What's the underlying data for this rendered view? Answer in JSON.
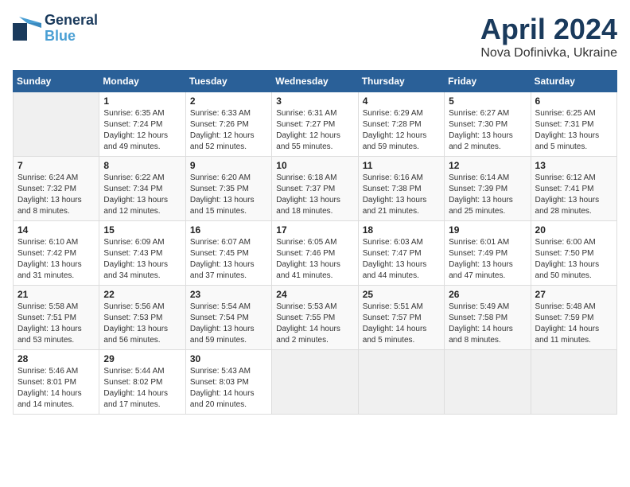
{
  "header": {
    "logo_line1": "General",
    "logo_line2": "Blue",
    "month": "April 2024",
    "location": "Nova Dofinivka, Ukraine"
  },
  "weekdays": [
    "Sunday",
    "Monday",
    "Tuesday",
    "Wednesday",
    "Thursday",
    "Friday",
    "Saturday"
  ],
  "weeks": [
    [
      {
        "day": "",
        "empty": true
      },
      {
        "day": "1",
        "sunrise": "6:35 AM",
        "sunset": "7:24 PM",
        "daylight": "12 hours and 49 minutes."
      },
      {
        "day": "2",
        "sunrise": "6:33 AM",
        "sunset": "7:26 PM",
        "daylight": "12 hours and 52 minutes."
      },
      {
        "day": "3",
        "sunrise": "6:31 AM",
        "sunset": "7:27 PM",
        "daylight": "12 hours and 55 minutes."
      },
      {
        "day": "4",
        "sunrise": "6:29 AM",
        "sunset": "7:28 PM",
        "daylight": "12 hours and 59 minutes."
      },
      {
        "day": "5",
        "sunrise": "6:27 AM",
        "sunset": "7:30 PM",
        "daylight": "13 hours and 2 minutes."
      },
      {
        "day": "6",
        "sunrise": "6:25 AM",
        "sunset": "7:31 PM",
        "daylight": "13 hours and 5 minutes."
      }
    ],
    [
      {
        "day": "7",
        "sunrise": "6:24 AM",
        "sunset": "7:32 PM",
        "daylight": "13 hours and 8 minutes."
      },
      {
        "day": "8",
        "sunrise": "6:22 AM",
        "sunset": "7:34 PM",
        "daylight": "13 hours and 12 minutes."
      },
      {
        "day": "9",
        "sunrise": "6:20 AM",
        "sunset": "7:35 PM",
        "daylight": "13 hours and 15 minutes."
      },
      {
        "day": "10",
        "sunrise": "6:18 AM",
        "sunset": "7:37 PM",
        "daylight": "13 hours and 18 minutes."
      },
      {
        "day": "11",
        "sunrise": "6:16 AM",
        "sunset": "7:38 PM",
        "daylight": "13 hours and 21 minutes."
      },
      {
        "day": "12",
        "sunrise": "6:14 AM",
        "sunset": "7:39 PM",
        "daylight": "13 hours and 25 minutes."
      },
      {
        "day": "13",
        "sunrise": "6:12 AM",
        "sunset": "7:41 PM",
        "daylight": "13 hours and 28 minutes."
      }
    ],
    [
      {
        "day": "14",
        "sunrise": "6:10 AM",
        "sunset": "7:42 PM",
        "daylight": "13 hours and 31 minutes."
      },
      {
        "day": "15",
        "sunrise": "6:09 AM",
        "sunset": "7:43 PM",
        "daylight": "13 hours and 34 minutes."
      },
      {
        "day": "16",
        "sunrise": "6:07 AM",
        "sunset": "7:45 PM",
        "daylight": "13 hours and 37 minutes."
      },
      {
        "day": "17",
        "sunrise": "6:05 AM",
        "sunset": "7:46 PM",
        "daylight": "13 hours and 41 minutes."
      },
      {
        "day": "18",
        "sunrise": "6:03 AM",
        "sunset": "7:47 PM",
        "daylight": "13 hours and 44 minutes."
      },
      {
        "day": "19",
        "sunrise": "6:01 AM",
        "sunset": "7:49 PM",
        "daylight": "13 hours and 47 minutes."
      },
      {
        "day": "20",
        "sunrise": "6:00 AM",
        "sunset": "7:50 PM",
        "daylight": "13 hours and 50 minutes."
      }
    ],
    [
      {
        "day": "21",
        "sunrise": "5:58 AM",
        "sunset": "7:51 PM",
        "daylight": "13 hours and 53 minutes."
      },
      {
        "day": "22",
        "sunrise": "5:56 AM",
        "sunset": "7:53 PM",
        "daylight": "13 hours and 56 minutes."
      },
      {
        "day": "23",
        "sunrise": "5:54 AM",
        "sunset": "7:54 PM",
        "daylight": "13 hours and 59 minutes."
      },
      {
        "day": "24",
        "sunrise": "5:53 AM",
        "sunset": "7:55 PM",
        "daylight": "14 hours and 2 minutes."
      },
      {
        "day": "25",
        "sunrise": "5:51 AM",
        "sunset": "7:57 PM",
        "daylight": "14 hours and 5 minutes."
      },
      {
        "day": "26",
        "sunrise": "5:49 AM",
        "sunset": "7:58 PM",
        "daylight": "14 hours and 8 minutes."
      },
      {
        "day": "27",
        "sunrise": "5:48 AM",
        "sunset": "7:59 PM",
        "daylight": "14 hours and 11 minutes."
      }
    ],
    [
      {
        "day": "28",
        "sunrise": "5:46 AM",
        "sunset": "8:01 PM",
        "daylight": "14 hours and 14 minutes."
      },
      {
        "day": "29",
        "sunrise": "5:44 AM",
        "sunset": "8:02 PM",
        "daylight": "14 hours and 17 minutes."
      },
      {
        "day": "30",
        "sunrise": "5:43 AM",
        "sunset": "8:03 PM",
        "daylight": "14 hours and 20 minutes."
      },
      {
        "day": "",
        "empty": true
      },
      {
        "day": "",
        "empty": true
      },
      {
        "day": "",
        "empty": true
      },
      {
        "day": "",
        "empty": true
      }
    ]
  ]
}
